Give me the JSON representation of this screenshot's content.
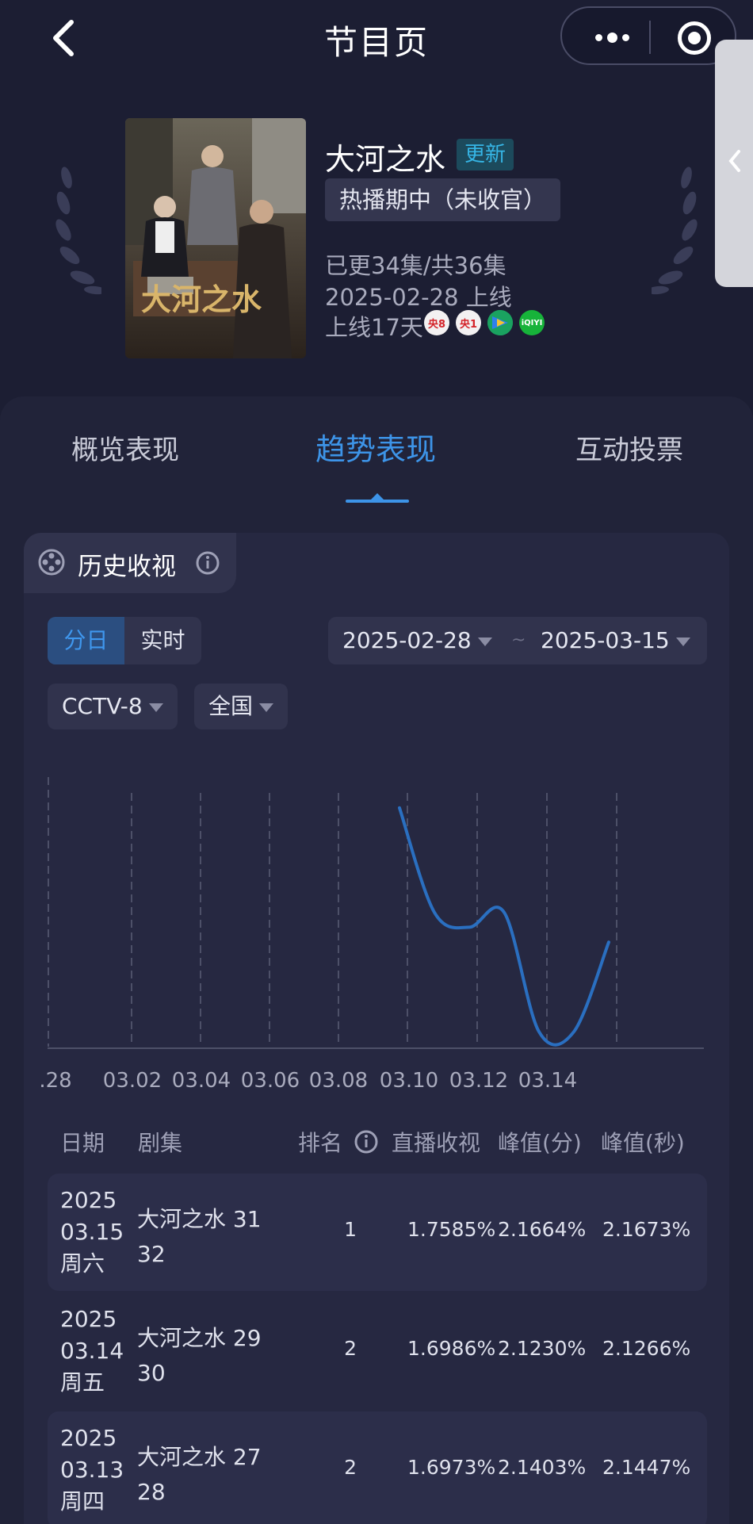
{
  "nav": {
    "title": "节目页"
  },
  "show": {
    "title": "大河之水",
    "update_badge": "更新",
    "status": "热播期中（未收官）",
    "episodes": "已更34集/共36集",
    "premiere": "2025-02-28 上线",
    "days_online": "上线17天",
    "poster_caption": "大河之水",
    "channels": [
      {
        "label": "央8",
        "icon": "cctv8-icon"
      },
      {
        "label": "央1",
        "icon": "cctv1-icon"
      },
      {
        "label": "",
        "icon": "video-play-icon"
      },
      {
        "label": "iQIYI",
        "icon": "iqiyi-icon"
      }
    ]
  },
  "tabs": [
    {
      "label": "概览表现",
      "active": false
    },
    {
      "label": "趋势表现",
      "active": true
    },
    {
      "label": "互动投票",
      "active": false
    }
  ],
  "section": {
    "title": "历史收视"
  },
  "filters": {
    "mode_options": [
      "分日",
      "实时"
    ],
    "mode_selected": "分日",
    "date_from": "2025-02-28",
    "date_separator": "~",
    "date_to": "2025-03-15",
    "channel": "CCTV-8",
    "region": "全国"
  },
  "chart_data": {
    "type": "line",
    "title": "",
    "xlabel": "",
    "ylabel": "",
    "x_tick_labels": [
      ".28",
      "03.02",
      "03.04",
      "03.06",
      "03.08",
      "03.10",
      "03.12",
      "03.14"
    ],
    "x": [
      "03.09",
      "03.10",
      "03.11",
      "03.12",
      "03.13",
      "03.14",
      "03.15"
    ],
    "series": [
      {
        "values": [
          1.85,
          1.78,
          1.77,
          1.78,
          1.7,
          1.7,
          1.76
        ]
      }
    ],
    "ylim": [
      1.69,
      1.86
    ],
    "grid": "vertical-dashed",
    "color": "#2a6fc0"
  },
  "table": {
    "headers": [
      "日期",
      "剧集",
      "排名",
      "直播收视",
      "峰值(分)",
      "峰值(秒)"
    ],
    "rows": [
      {
        "year": "2025",
        "date": "03.15",
        "weekday": "周六",
        "ep_line1": "大河之水 31",
        "ep_line2": "32",
        "rank": "1",
        "live": "1.7585%",
        "peak_min": "2.1664%",
        "peak_sec": "2.1673%"
      },
      {
        "year": "2025",
        "date": "03.14",
        "weekday": "周五",
        "ep_line1": "大河之水 29",
        "ep_line2": "30",
        "rank": "2",
        "live": "1.6986%",
        "peak_min": "2.1230%",
        "peak_sec": "2.1266%"
      },
      {
        "year": "2025",
        "date": "03.13",
        "weekday": "周四",
        "ep_line1": "大河之水 27",
        "ep_line2": "28",
        "rank": "2",
        "live": "1.6973%",
        "peak_min": "2.1403%",
        "peak_sec": "2.1447%"
      }
    ]
  },
  "colors": {
    "background": "#1c1e33",
    "accent": "#3d94e8",
    "line": "#2a6fc0"
  }
}
